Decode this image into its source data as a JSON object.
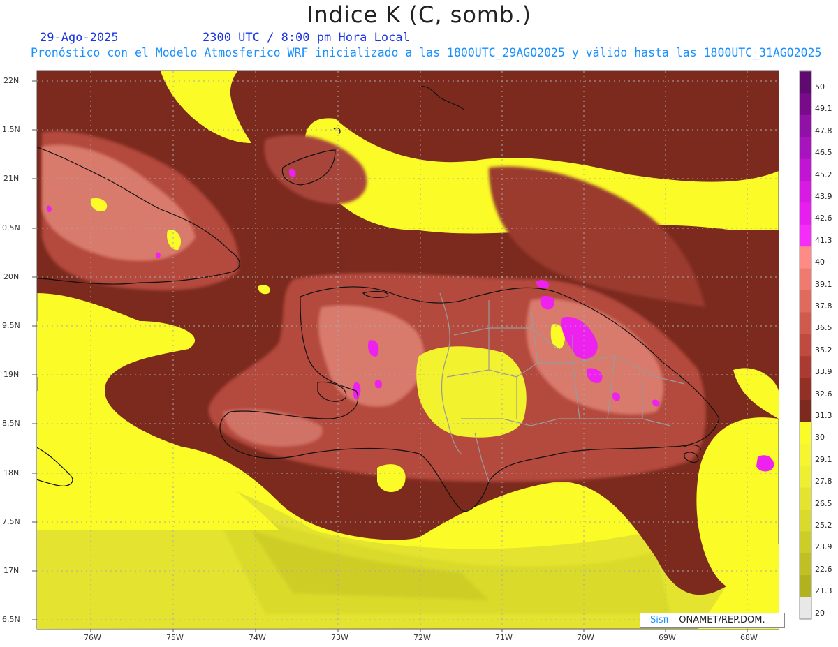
{
  "title": "Indice K (C, somb.)",
  "date": "29-Ago-2025",
  "time": "2300 UTC / 8:00 pm Hora Local",
  "subtitle": "Pronóstico con el Modelo Atmosferico WRF inicializado a las 1800UTC_29AGO2025 y válido hasta las  1800UTC_31AGO2025",
  "credit": {
    "logo": "Sisπ",
    "org": "– ONAMET/REP.DOM."
  },
  "lat_labels": [
    "22N",
    "1.5N",
    "21N",
    "0.5N",
    "20N",
    "9.5N",
    "19N",
    "8.5N",
    "18N",
    "7.5N",
    "17N",
    "6.5N"
  ],
  "lon_labels": [
    "76W",
    "75W",
    "74W",
    "73W",
    "72W",
    "71W",
    "70W",
    "69W",
    "68W"
  ],
  "colorbar": {
    "labels": [
      "50",
      "49.1",
      "47.8",
      "46.5",
      "45.2",
      "43.9",
      "42.6",
      "41.3",
      "40",
      "39.1",
      "37.8",
      "36.5",
      "35.2",
      "33.9",
      "32.6",
      "31.3",
      "30",
      "29.1",
      "27.8",
      "26.5",
      "25.2",
      "23.9",
      "22.6",
      "21.3",
      "20"
    ],
    "colors": [
      "#5e0a6e",
      "#7a0a8c",
      "#9010a8",
      "#a813c0",
      "#c215d4",
      "#d81ae4",
      "#e81ef0",
      "#f62df8",
      "#ff8a86",
      "#f07a70",
      "#e06a5e",
      "#d05a4e",
      "#c04a40",
      "#aa3a32",
      "#923026",
      "#7c2a1e",
      "#fbfb28",
      "#f6f630",
      "#eeee32",
      "#e4e430",
      "#dada2c",
      "#cdcd28",
      "#c0c024",
      "#b2b21e",
      "#e8e8e8"
    ]
  },
  "colors": {
    "background_yellow": "#fbfb28",
    "dark_brown": "#7c2a1e",
    "mid_brown": "#b44a3c",
    "light_salmon": "#e08a7e",
    "magenta": "#ee22ee",
    "coast": "#111111",
    "province_border": "#999999"
  }
}
